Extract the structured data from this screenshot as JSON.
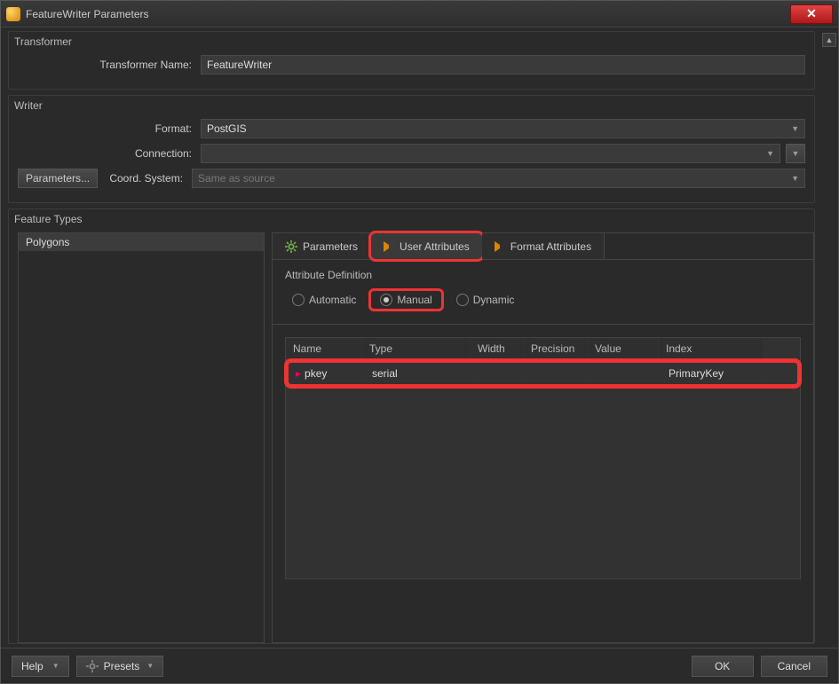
{
  "window": {
    "title": "FeatureWriter Parameters"
  },
  "transformer": {
    "group_label": "Transformer",
    "name_label": "Transformer Name:",
    "name_value": "FeatureWriter"
  },
  "writer": {
    "group_label": "Writer",
    "format_label": "Format:",
    "format_value": "PostGIS",
    "connection_label": "Connection:",
    "connection_value": "",
    "coord_label": "Coord. System:",
    "coord_placeholder": "Same as source",
    "parameters_btn": "Parameters..."
  },
  "feature_types": {
    "group_label": "Feature Types",
    "list": [
      {
        "name": "Polygons"
      }
    ],
    "tabs": {
      "parameters": "Parameters",
      "user_attributes": "User Attributes",
      "format_attributes": "Format Attributes"
    },
    "attr_def_label": "Attribute Definition",
    "radios": {
      "automatic": "Automatic",
      "manual": "Manual",
      "dynamic": "Dynamic",
      "selected": "manual"
    },
    "table": {
      "headers": {
        "name": "Name",
        "type": "Type",
        "width": "Width",
        "precision": "Precision",
        "value": "Value",
        "index": "Index"
      },
      "rows": [
        {
          "name": "pkey",
          "type": "serial",
          "width": "",
          "precision": "",
          "value": "",
          "index": "PrimaryKey"
        }
      ]
    }
  },
  "footer": {
    "help": "Help",
    "presets": "Presets",
    "ok": "OK",
    "cancel": "Cancel"
  }
}
